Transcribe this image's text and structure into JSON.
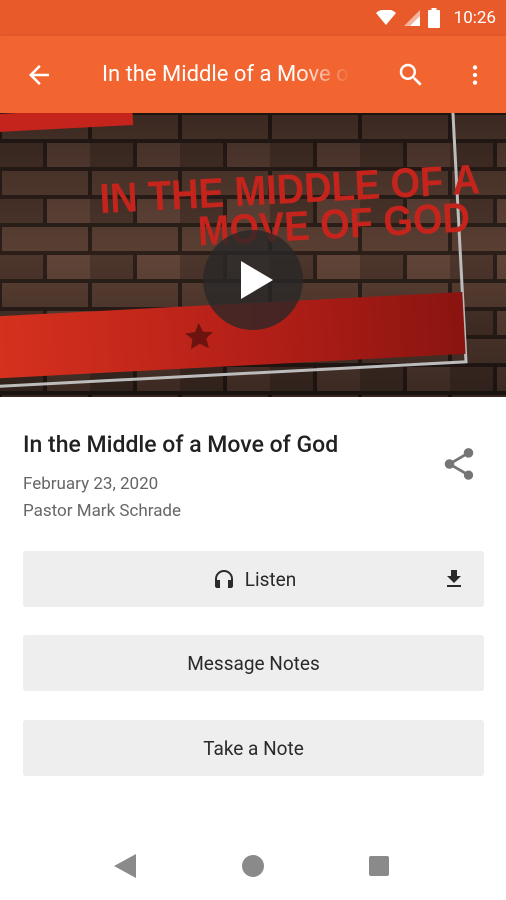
{
  "status_bar": {
    "time": "10:26",
    "icons": [
      "wifi-icon",
      "signal-icon",
      "battery-icon"
    ]
  },
  "app_bar": {
    "title": "In the Middle of a Move of God",
    "back_icon": "arrow-back-icon",
    "search_icon": "search-icon",
    "more_icon": "more-vert-icon"
  },
  "hero": {
    "artwork_text_line1": "IN THE MIDDLE OF A",
    "artwork_text_line2": "MOVE OF GOD",
    "play_icon": "play-icon"
  },
  "sermon": {
    "title": "In the Middle of a Move of God",
    "date": "February 23, 2020",
    "speaker": "Pastor Mark Schrade",
    "share_icon": "share-icon"
  },
  "actions": {
    "listen": "Listen",
    "message_notes": "Message Notes",
    "take_note": "Take a Note"
  },
  "colors": {
    "primary": "#f26531",
    "status_bar": "#e85a2a",
    "artwork_red": "#c4241c"
  }
}
